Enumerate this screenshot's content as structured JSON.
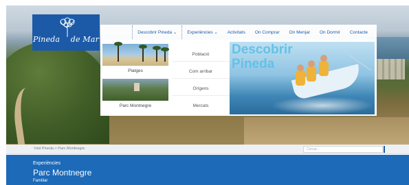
{
  "logo": {
    "text_left": "Pineda",
    "text_right": "de Mar"
  },
  "nav": {
    "items": [
      {
        "label": "Descobrir Pineda ⌄",
        "active": true
      },
      {
        "label": "Experiències ⌄",
        "active": false
      },
      {
        "label": "Activitats",
        "active": false
      },
      {
        "label": "On Comprar",
        "active": false
      },
      {
        "label": "On Menjar",
        "active": false
      },
      {
        "label": "On Dormir",
        "active": false
      },
      {
        "label": "Contacte",
        "active": false
      }
    ]
  },
  "dropdown": {
    "thumbs": [
      {
        "label": "Platges"
      },
      {
        "label": "Parc Montnegre"
      }
    ],
    "links": [
      {
        "label": "Població"
      },
      {
        "label": "Com arribar"
      },
      {
        "label": "Orígens"
      },
      {
        "label": "Mercats"
      }
    ],
    "promo": {
      "line1": "Descobrir",
      "line2": "Pineda"
    }
  },
  "breadcrumb": {
    "text": "Visit Pineda > Parc Montnegre"
  },
  "search": {
    "placeholder": "Cercar..."
  },
  "page": {
    "section": "Experiències",
    "title": "Parc Montnegre",
    "subtitle": "Familiar"
  },
  "colors": {
    "brand_blue": "#1c6ab8",
    "logo_blue": "#1c5aa8",
    "promo_text": "#5cc0e6"
  }
}
